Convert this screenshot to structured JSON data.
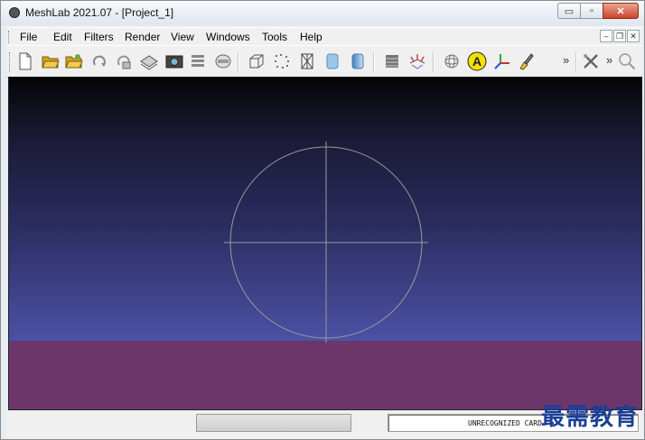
{
  "window": {
    "title": "MeshLab 2021.07 - [Project_1]",
    "app_icon": "meshlab-logo-icon",
    "controls": {
      "minimize": "▭",
      "maximize": "▫",
      "close": "✕"
    }
  },
  "menubar": {
    "items": [
      "File",
      "Edit",
      "Filters",
      "Render",
      "View",
      "Windows",
      "Tools",
      "Help"
    ],
    "mdi_controls": {
      "minimize": "–",
      "restore": "❐",
      "close": "✕"
    }
  },
  "toolbar": {
    "overflow_label": "»",
    "icons": [
      "new-empty-project-icon",
      "open-project-icon",
      "import-mesh-icon",
      "reload-icon",
      "reload-all-icon",
      "export-mesh-icon",
      "save-snapshot-icon",
      "layers-icon",
      "raster-layers-icon",
      "bounding-box-icon",
      "points-icon",
      "wireframe-icon",
      "flat-shading-icon",
      "smooth-shading-icon",
      "texture-icon",
      "normals-icon",
      "trackball-icon",
      "annotation-icon",
      "axes-icon",
      "paint-brush-icon",
      "tools-icon",
      "zoom-icon"
    ]
  },
  "statusbar": {
    "progress": 0,
    "text": "UNRECOGNIZED CARD"
  },
  "watermark": "最需教育",
  "colors": {
    "viewport_top": "#050507",
    "viewport_bottom": "#5960bf",
    "ground": "#6c366a",
    "trackball": "#9a9a9a",
    "watermark": "#1b3f95"
  }
}
